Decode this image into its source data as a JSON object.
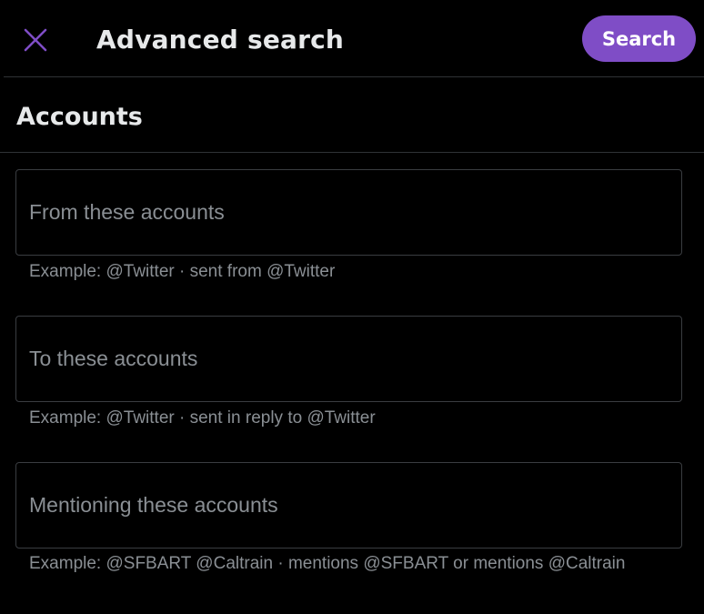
{
  "header": {
    "title": "Advanced search",
    "search_label": "Search",
    "close_icon": "close-icon"
  },
  "accounts": {
    "heading": "Accounts",
    "fields": [
      {
        "placeholder": "From these accounts",
        "value": "",
        "hint": "Example: @Twitter · sent from @Twitter"
      },
      {
        "placeholder": "To these accounts",
        "value": "",
        "hint": "Example: @Twitter · sent in reply to @Twitter"
      },
      {
        "placeholder": "Mentioning these accounts",
        "value": "",
        "hint": "Example: @SFBART @Caltrain · mentions @SFBART or mentions @Caltrain"
      }
    ]
  },
  "colors": {
    "accent": "#7f4dc6",
    "background": "#000000",
    "placeholder": "#8a8f94",
    "divider": "#2f3336"
  }
}
